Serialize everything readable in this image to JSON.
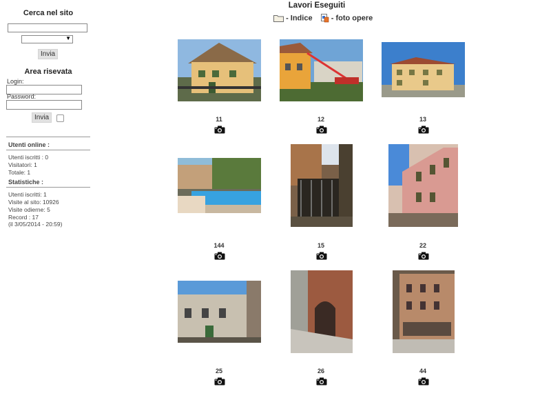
{
  "sidebar": {
    "search": {
      "title": "Cerca nel sito",
      "value": "",
      "select_value": "",
      "submit_label": "Invia"
    },
    "login": {
      "title": "Area risevata",
      "login_label": "Login:",
      "password_label": "Password:",
      "submit_label": "Invia"
    },
    "stats": {
      "online_title": "Utenti online :",
      "online_lines": [
        "Utenti iscritti : 0",
        "Visitatori: 1",
        "Totale: 1"
      ],
      "stats_title": "Statistiche :",
      "stats_lines": [
        "Utenti iscritti: 1",
        "Visite al sito: 10926",
        "Visite odierne: 5",
        "Record : 17",
        "(il 3/05/2014 - 20:59)"
      ]
    }
  },
  "main": {
    "title": "Lavori Eseguiti",
    "nav": {
      "index_label": "- Indice",
      "photos_label": "- foto opere"
    },
    "gallery": [
      {
        "id": "11",
        "icon": "camera-icon"
      },
      {
        "id": "12",
        "icon": "camera-icon"
      },
      {
        "id": "13",
        "icon": "camera-icon"
      },
      {
        "id": "144",
        "icon": "camera-icon"
      },
      {
        "id": "15",
        "icon": "camera-icon"
      },
      {
        "id": "22",
        "icon": "camera-icon"
      },
      {
        "id": "25",
        "icon": "camera-icon"
      },
      {
        "id": "26",
        "icon": "camera-icon"
      },
      {
        "id": "44",
        "icon": "camera-icon"
      }
    ]
  }
}
